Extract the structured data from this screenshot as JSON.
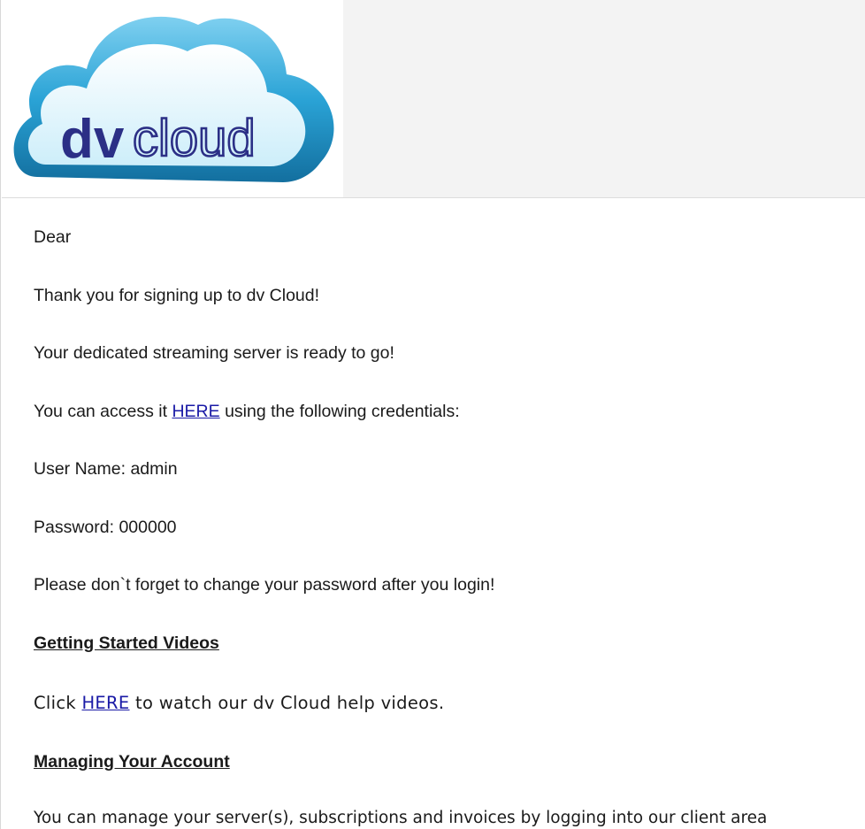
{
  "logo": {
    "brand_bold": "dv",
    "brand_light": "cloud",
    "colors": {
      "cloud_outer": "#1f8fc2",
      "cloud_inner": "#bfe6f6",
      "text_navy": "#2b2f86"
    }
  },
  "message": {
    "greeting": "Dear",
    "thanks": "Thank you for signing up to dv Cloud!",
    "ready": "Your dedicated streaming server is ready to go!",
    "access_prefix": "You can access it ",
    "access_link": "HERE",
    "access_suffix": " using the following credentials:",
    "username_line": "User Name: admin",
    "password_line": "Password: 000000",
    "reminder": "Please don`t forget to change your password after you login!",
    "videos_heading": "Getting Started Videos",
    "videos_prefix": "Click ",
    "videos_link": "HERE",
    "videos_suffix": " to watch our dv Cloud help videos.",
    "account_heading": "Managing Your Account",
    "account_text": "You can manage your server(s), subscriptions and invoices by logging into our client area"
  },
  "colors": {
    "link": "#1a1aa6",
    "text": "#1a1a1a",
    "header_bg": "#f3f3f3"
  }
}
